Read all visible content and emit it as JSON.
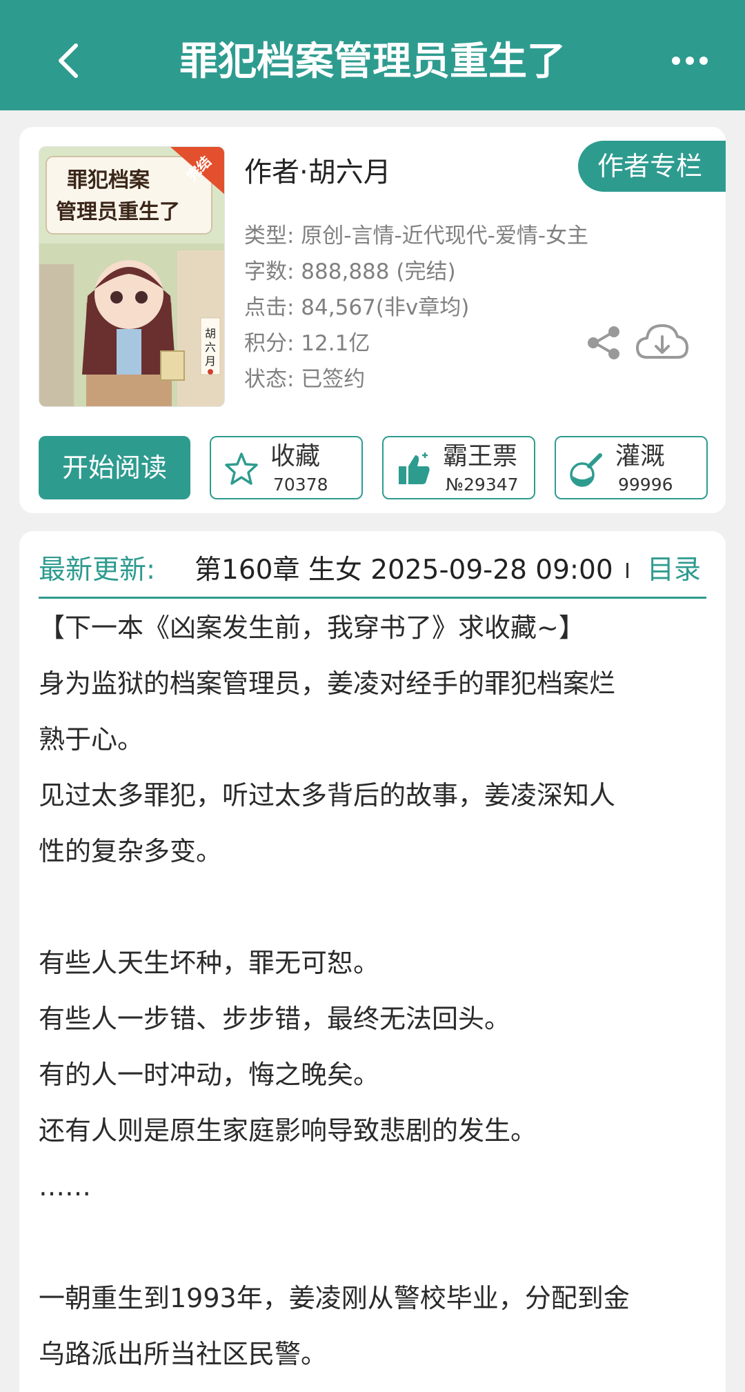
{
  "header": {
    "title": "罪犯档案管理员重生了",
    "back_icon": "chevron-left-icon",
    "more_icon": "more-horizontal-icon"
  },
  "book": {
    "cover": {
      "title_line1": "罪犯档案",
      "title_line2": "管理员重生了",
      "badge": "完结",
      "signature": "胡六月"
    },
    "author_line": "作者·胡六月",
    "author_column_label": "作者专栏",
    "info": {
      "type": "类型: 原创-言情-近代现代-爱情-女主",
      "words": "字数: 888,888 (完结)",
      "clicks": "点击: 84,567(非v章均)",
      "score": "积分: 12.1亿",
      "status": "状态: 已签约"
    },
    "share_icon": "share-icon",
    "download_icon": "cloud-download-icon"
  },
  "actions": {
    "read_label": "开始阅读",
    "collect": {
      "label": "收藏",
      "count": "70378",
      "icon": "star-icon"
    },
    "bawang": {
      "label": "霸王票",
      "count": "№29347",
      "icon": "thumbs-up-icon"
    },
    "irrigate": {
      "label": "灌溉",
      "count": "99996",
      "icon": "watering-flask-icon"
    }
  },
  "update": {
    "label": "最新更新:",
    "text": "第160章  生女  2025-09-28 09:00",
    "toc_label": "目录"
  },
  "description": [
    "【下一本《凶案发生前，我穿书了》求收藏~】",
    "身为监狱的档案管理员，姜凌对经手的罪犯档案烂",
    "熟于心。",
    "见过太多罪犯，听过太多背后的故事，姜凌深知人",
    "性的复杂多变。",
    "",
    "有些人天生坏种，罪无可恕。",
    "有些人一步错、步步错，最终无法回头。",
    "有的人一时冲动，悔之晚矣。",
    "还有人则是原生家庭影响导致悲剧的发生。",
    "……",
    "",
    "一朝重生到1993年，姜凌刚从警校毕业，分配到金",
    "乌路派出所当社区民警。"
  ],
  "colors": {
    "brand": "#2e9b8f",
    "background": "#f0f0f0"
  }
}
